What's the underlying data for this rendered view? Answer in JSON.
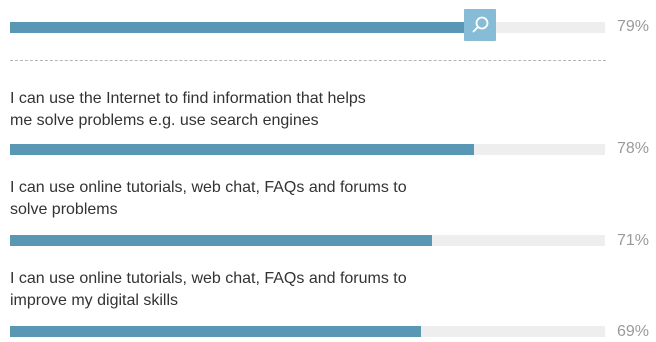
{
  "chart_data": {
    "type": "bar",
    "orientation": "horizontal",
    "xlim": [
      0,
      100
    ],
    "categories": [
      "",
      "I can use the Internet to find information that helps me solve problems e.g. use search engines",
      "I can use online tutorials, web chat, FAQs and forums to solve problems",
      "I can use online tutorials, web chat, FAQs and forums to improve my digital skills"
    ],
    "values": [
      79,
      78,
      71,
      69
    ],
    "value_labels": [
      "79%",
      "78%",
      "71%",
      "69%"
    ],
    "colors": {
      "bar": "#5a97b4",
      "track": "#eeeeee",
      "icon_bg": "#87bcd6",
      "value_text": "#9a9a9a"
    },
    "icon": "search-icon"
  },
  "labels": {
    "row2_line1": "I can use the Internet to find information that helps",
    "row2_line2": "me solve problems e.g. use search engines",
    "row3_line1": "I can use online tutorials, web chat, FAQs and forums to",
    "row3_line2": "solve problems",
    "row4_line1": "I can use online tutorials, web chat, FAQs and forums to",
    "row4_line2": "improve my digital skills"
  }
}
